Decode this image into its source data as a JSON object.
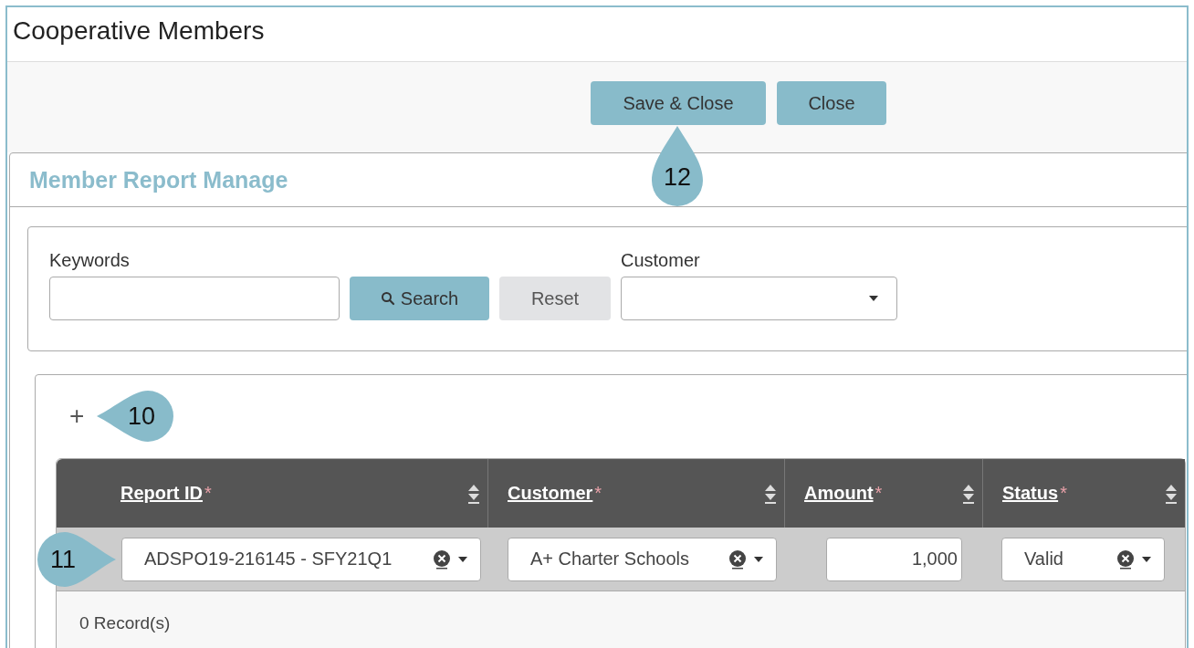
{
  "window": {
    "title": "Cooperative Members"
  },
  "toolbar": {
    "buttons": [
      {
        "label": "Save & Close",
        "kind": "primary"
      },
      {
        "label": "Close",
        "kind": "primary"
      }
    ],
    "callout": "12"
  },
  "panel": {
    "title": "Member Report Manage"
  },
  "search": {
    "keywords_label": "Keywords",
    "search_button": "Search",
    "reset_button": "Reset",
    "customer_label": "Customer"
  },
  "grid": {
    "add_label": "+",
    "callout": "10",
    "columns": [
      {
        "label": "Report ID",
        "required_mark": "*"
      },
      {
        "label": "Customer",
        "required_mark": "*"
      },
      {
        "label": "Amount",
        "required_mark": "*"
      },
      {
        "label": "Status",
        "required_mark": "*"
      }
    ],
    "rows": [
      {
        "callout": "11",
        "cells": [
          {
            "kind": "select",
            "value": "ADSPO19-216145 - SFY21Q1",
            "clearable": true
          },
          {
            "kind": "select",
            "value": "A+ Charter Schools",
            "clearable": true
          },
          {
            "kind": "number",
            "value": "1,000"
          },
          {
            "kind": "select",
            "value": "Valid",
            "clearable": true
          }
        ]
      }
    ],
    "footer": "0 Record(s)"
  }
}
